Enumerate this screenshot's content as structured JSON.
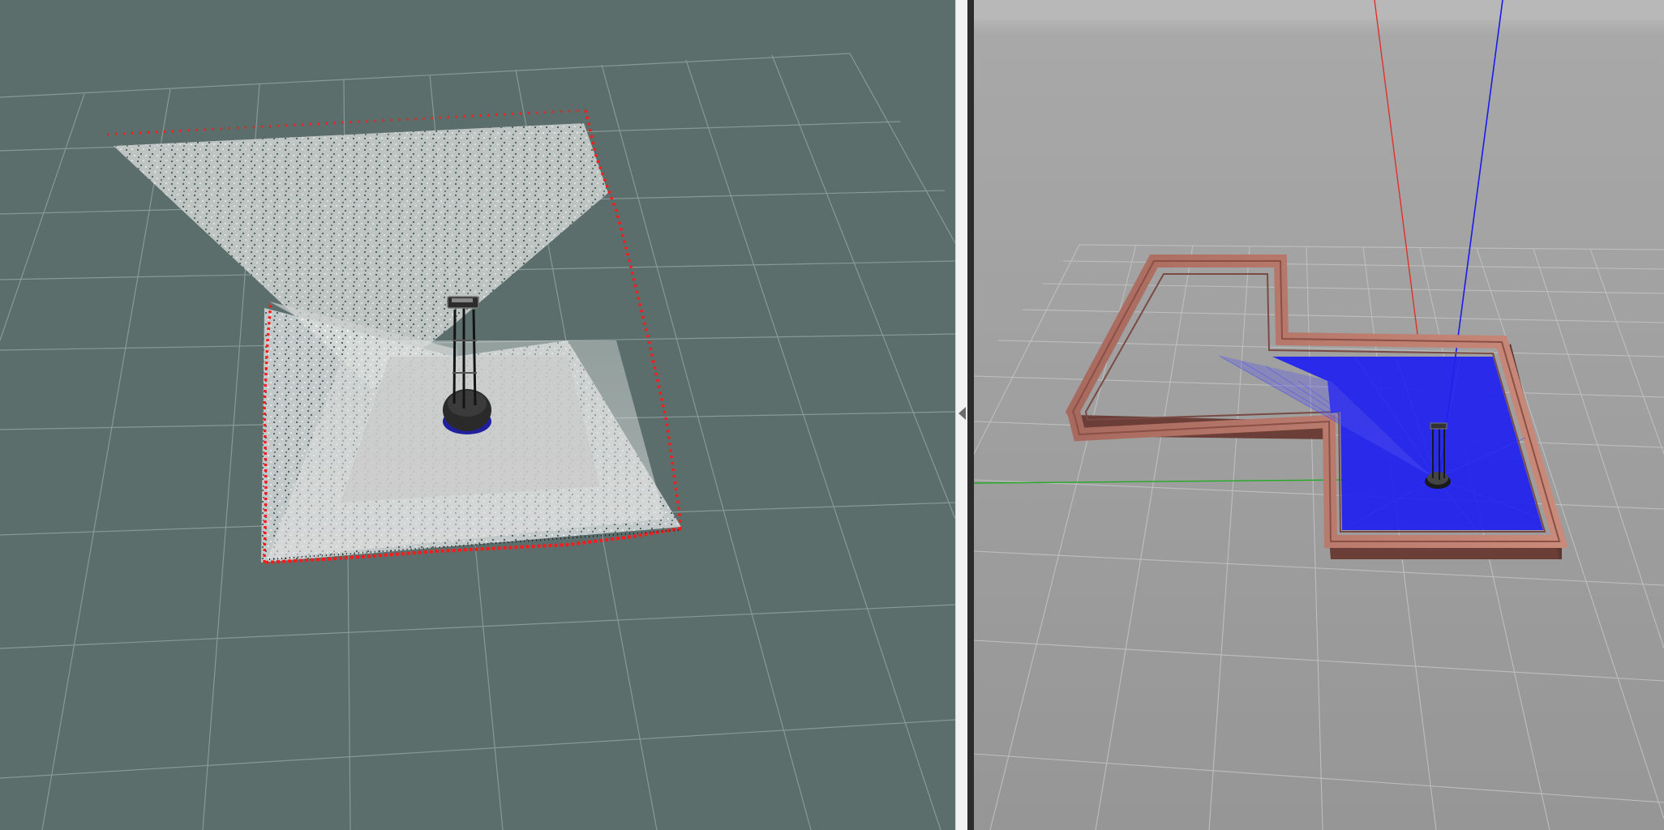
{
  "views": [
    {
      "name": "rviz-3d-view",
      "background": "#5b6e6b",
      "grid_color": "#8fa19e",
      "laser_color": "#ff1a1a"
    },
    {
      "name": "gazebo-3d-view",
      "background": "#9b9b9b",
      "grid_color": "#c4c4c4",
      "laser_color": "#1a1aff",
      "wall_color": "#7a4a44"
    }
  ],
  "splitter": {
    "icon": "collapse-left-arrow-icon"
  },
  "axes": {
    "x_color": "#e0302a",
    "y_color": "#22aa22",
    "z_color": "#1a1aee"
  }
}
